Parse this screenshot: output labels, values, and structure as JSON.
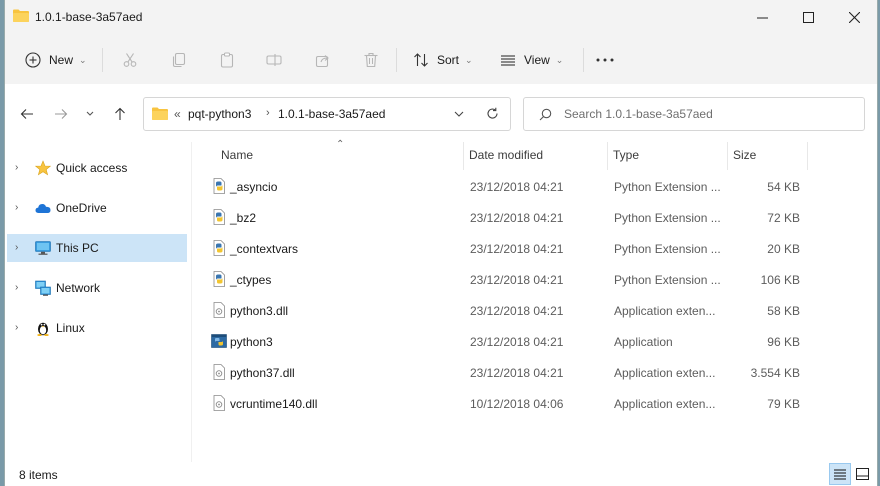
{
  "window": {
    "title": "1.0.1-base-3a57aed"
  },
  "toolbar": {
    "new_label": "New",
    "sort_label": "Sort",
    "view_label": "View"
  },
  "address": {
    "overflow": "«",
    "crumbs": [
      "pqt-python3",
      "1.0.1-base-3a57aed"
    ]
  },
  "search": {
    "placeholder": "Search 1.0.1-base-3a57aed"
  },
  "sidebar": {
    "items": [
      {
        "label": "Quick access",
        "icon": "star-icon"
      },
      {
        "label": "OneDrive",
        "icon": "cloud-icon"
      },
      {
        "label": "This PC",
        "icon": "monitor-icon",
        "selected": true
      },
      {
        "label": "Network",
        "icon": "network-icon"
      },
      {
        "label": "Linux",
        "icon": "penguin-icon"
      }
    ]
  },
  "columns": {
    "name": "Name",
    "date": "Date modified",
    "type": "Type",
    "size": "Size"
  },
  "files": [
    {
      "name": "_asyncio",
      "date": "23/12/2018 04:21",
      "type": "Python Extension ...",
      "size": "54 KB",
      "icon": "python-extension-icon"
    },
    {
      "name": "_bz2",
      "date": "23/12/2018 04:21",
      "type": "Python Extension ...",
      "size": "72 KB",
      "icon": "python-extension-icon"
    },
    {
      "name": "_contextvars",
      "date": "23/12/2018 04:21",
      "type": "Python Extension ...",
      "size": "20 KB",
      "icon": "python-extension-icon"
    },
    {
      "name": "_ctypes",
      "date": "23/12/2018 04:21",
      "type": "Python Extension ...",
      "size": "106 KB",
      "icon": "python-extension-icon"
    },
    {
      "name": "python3.dll",
      "date": "23/12/2018 04:21",
      "type": "Application exten...",
      "size": "58 KB",
      "icon": "dll-file-icon"
    },
    {
      "name": "python3",
      "date": "23/12/2018 04:21",
      "type": "Application",
      "size": "96 KB",
      "icon": "application-icon"
    },
    {
      "name": "python37.dll",
      "date": "23/12/2018 04:21",
      "type": "Application exten...",
      "size": "3.554 KB",
      "icon": "dll-file-icon"
    },
    {
      "name": "vcruntime140.dll",
      "date": "10/12/2018 04:06",
      "type": "Application exten...",
      "size": "79 KB",
      "icon": "dll-file-icon"
    }
  ],
  "status": {
    "item_count": "8 items"
  },
  "colors": {
    "selection": "#cce4f7",
    "folder": "#f8c440",
    "accent": "#0067c0"
  }
}
